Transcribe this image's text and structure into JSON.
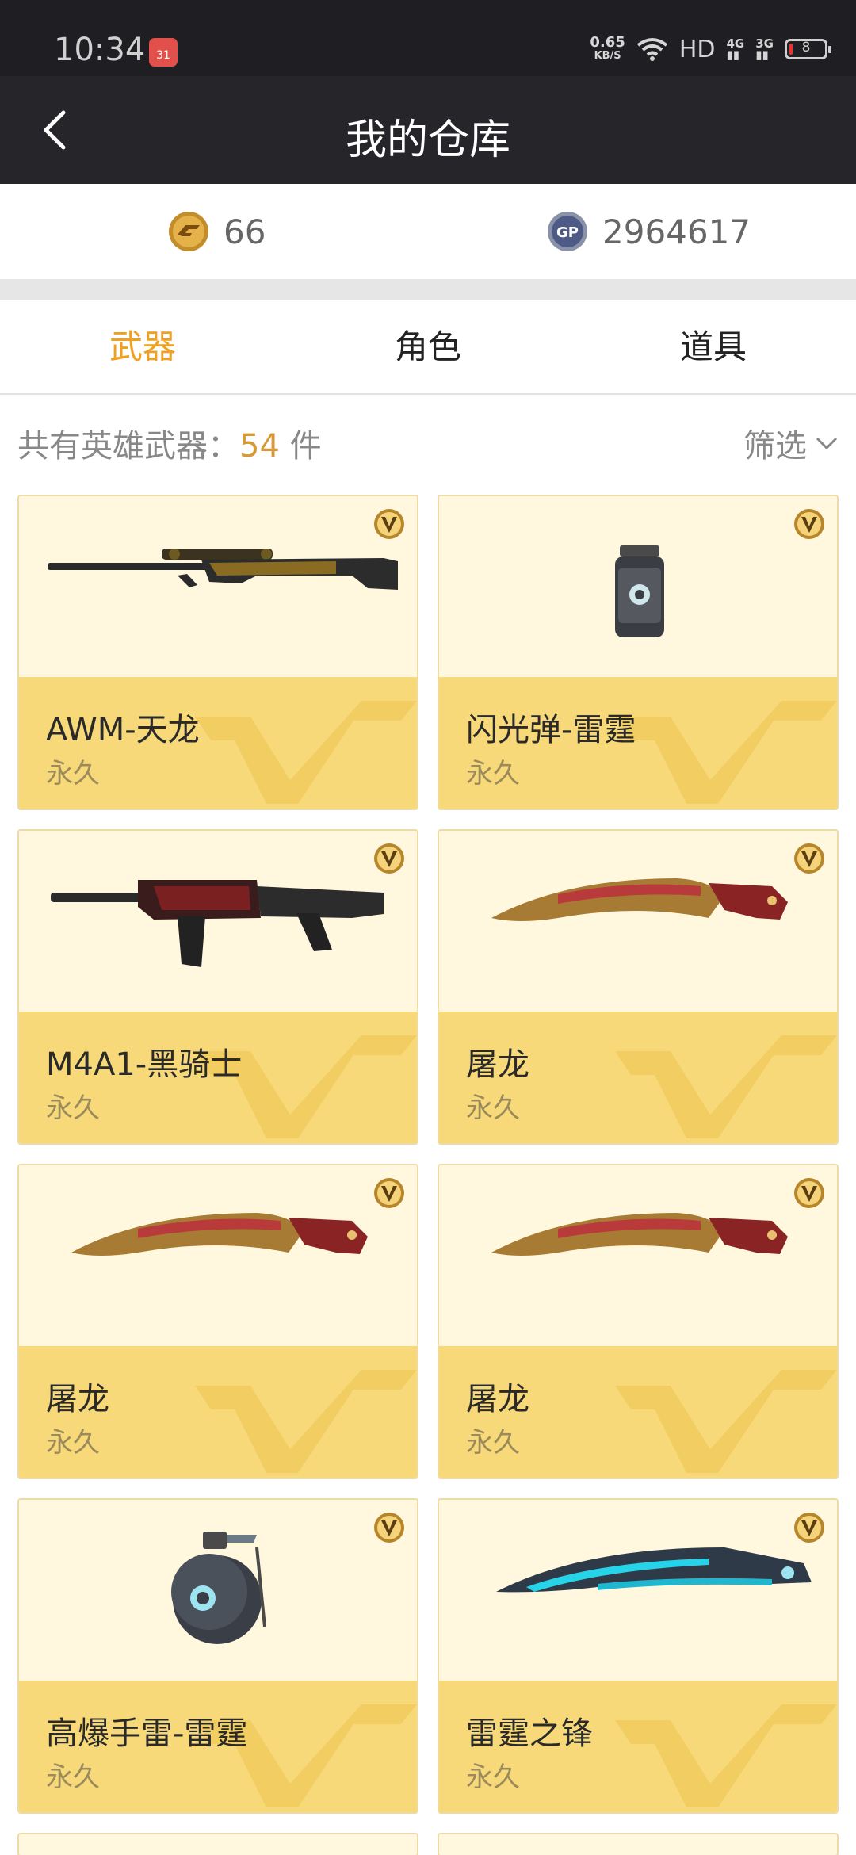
{
  "status_bar": {
    "time": "10:34",
    "calendar_day": "31",
    "net_speed": "0.65",
    "net_unit": "KB/S",
    "hd": "HD",
    "signal1": "4G",
    "signal2": "3G",
    "battery": "8",
    "battery_level": 0.08
  },
  "header": {
    "title": "我的仓库"
  },
  "currency": {
    "cf_points": "66",
    "gp_points": "2964617",
    "gp_label": "GP"
  },
  "tabs": [
    {
      "label": "武器",
      "active": true
    },
    {
      "label": "角色",
      "active": false
    },
    {
      "label": "道具",
      "active": false
    }
  ],
  "summary": {
    "prefix": "共有英雄武器：",
    "count": "54",
    "suffix": " 件",
    "filter_label": "筛选"
  },
  "items": [
    {
      "name": "AWM-天龙",
      "duration": "永久",
      "icon": "sniper-rifle-icon"
    },
    {
      "name": "闪光弹-雷霆",
      "duration": "永久",
      "icon": "flash-grenade-icon"
    },
    {
      "name": "M4A1-黑骑士",
      "duration": "永久",
      "icon": "assault-rifle-icon"
    },
    {
      "name": "屠龙",
      "duration": "永久",
      "icon": "machete-icon"
    },
    {
      "name": "屠龙",
      "duration": "永久",
      "icon": "machete-icon"
    },
    {
      "name": "屠龙",
      "duration": "永久",
      "icon": "machete-icon"
    },
    {
      "name": "高爆手雷-雷霆",
      "duration": "永久",
      "icon": "frag-grenade-icon"
    },
    {
      "name": "雷霆之锋",
      "duration": "永久",
      "icon": "blade-icon"
    }
  ]
}
